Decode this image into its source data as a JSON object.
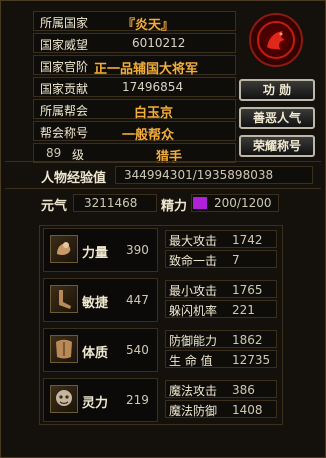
{
  "profile": {
    "rows": [
      {
        "label": "所属国家",
        "value": "『炎天』"
      },
      {
        "label": "国家威望",
        "value": "6010212"
      },
      {
        "label": "国家官阶",
        "value": "正一品辅国大将军"
      },
      {
        "label": "国家贡献",
        "value": "17496854"
      },
      {
        "label": "所属帮会",
        "value": "白玉京"
      },
      {
        "label": "帮会称号",
        "value": "一般帮众"
      }
    ],
    "level_value": "89",
    "level_unit": "级",
    "class_name": "猎手"
  },
  "buttons": {
    "merit": "功 勋",
    "karma": "善恶人气",
    "honor": "荣耀称号"
  },
  "experience": {
    "label": "人物经验值",
    "value": "344994301/1935898038"
  },
  "vitals": {
    "yuanqi_label": "元气",
    "yuanqi_value": "3211468",
    "energy_label": "精力",
    "energy_value": "200/1200",
    "energy_fraction": 0.1667
  },
  "stats": [
    {
      "label": "力量",
      "value": "390",
      "sub": [
        {
          "l": "最大攻击",
          "v": "1742"
        },
        {
          "l": "致命一击",
          "v": "7"
        }
      ]
    },
    {
      "label": "敏捷",
      "value": "447",
      "sub": [
        {
          "l": "最小攻击",
          "v": "1765"
        },
        {
          "l": "躲闪机率",
          "v": "221"
        }
      ]
    },
    {
      "label": "体质",
      "value": "540",
      "sub": [
        {
          "l": "防御能力",
          "v": "1862"
        },
        {
          "l": "生 命 值",
          "v": "12735"
        }
      ]
    },
    {
      "label": "灵力",
      "value": "219",
      "sub": [
        {
          "l": "魔法攻击",
          "v": "386"
        },
        {
          "l": "魔法防御",
          "v": "1408"
        }
      ]
    }
  ],
  "colors": {
    "accent_gold": "#f2ad3c",
    "energy_purple": "#b020d8",
    "border": "#3a2f1c"
  }
}
